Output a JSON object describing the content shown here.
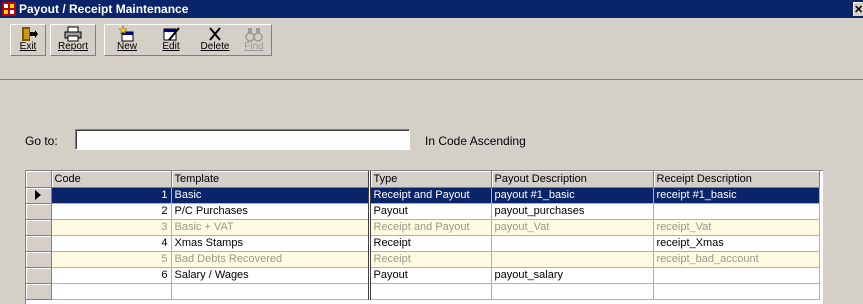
{
  "window": {
    "title": "Payout / Receipt Maintenance"
  },
  "toolbar": {
    "buttons": [
      {
        "label": "Exit",
        "icon": "exit-door-icon",
        "enabled": true
      },
      {
        "label": "Report",
        "icon": "printer-icon",
        "enabled": true
      },
      {
        "label": "New",
        "icon": "new-record-icon",
        "enabled": true
      },
      {
        "label": "Edit",
        "icon": "edit-record-icon",
        "enabled": true
      },
      {
        "label": "Delete",
        "icon": "delete-x-icon",
        "enabled": true
      },
      {
        "label": "Find",
        "icon": "binoculars-icon",
        "enabled": false
      }
    ]
  },
  "search": {
    "label": "Go to:",
    "value": "",
    "order_text": "In Code Ascending"
  },
  "grid": {
    "columns": [
      "Code",
      "Template",
      "Type",
      "Payout Description",
      "Receipt Description"
    ],
    "rows": [
      {
        "code": "1",
        "template": "Basic",
        "type": "Receipt and Payout",
        "payout": "payout #1_basic",
        "receipt": "receipt #1_basic",
        "state": "selected"
      },
      {
        "code": "2",
        "template": "P/C Purchases",
        "type": "Payout",
        "payout": "payout_purchases",
        "receipt": "",
        "state": "normal"
      },
      {
        "code": "3",
        "template": "Basic + VAT",
        "type": "Receipt and Payout",
        "payout": "payout_Vat",
        "receipt": "receipt_Vat",
        "state": "inactive"
      },
      {
        "code": "4",
        "template": "Xmas Stamps",
        "type": "Receipt",
        "payout": "",
        "receipt": "receipt_Xmas",
        "state": "normal"
      },
      {
        "code": "5",
        "template": "Bad Debts Recovered",
        "type": "Receipt",
        "payout": "",
        "receipt": "receipt_bad_account",
        "state": "inactive"
      },
      {
        "code": "6",
        "template": "Salary / Wages",
        "type": "Payout",
        "payout": "payout_salary",
        "receipt": "",
        "state": "normal"
      }
    ]
  },
  "colors": {
    "titlebar": "#0a246a",
    "face": "#d4d0c8",
    "selected_row": "#0a246a",
    "inactive_row": "#fffbe0"
  }
}
